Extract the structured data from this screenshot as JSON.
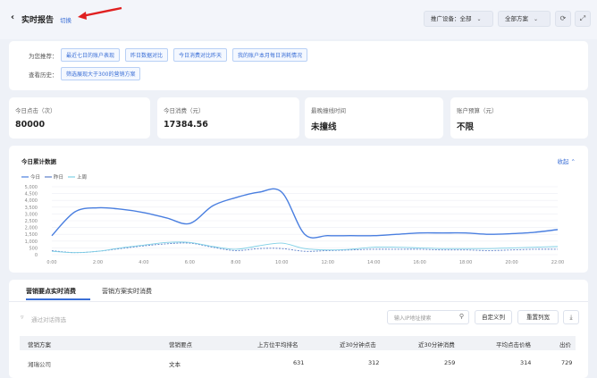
{
  "header": {
    "back_icon": "chevron-left-icon",
    "title": "实时报告",
    "switch_label": "切换",
    "device_select": "推广设备：全部",
    "plan_select": "全部方案",
    "refresh_icon": "refresh-icon",
    "fullscreen_icon": "expand-icon",
    "annotation_arrow_color": "#e02020"
  },
  "recommend": {
    "label": "为您推荐：",
    "tags": [
      "最近七日的账户表现",
      "昨日数据对比",
      "今日消费对比昨天",
      "我的账户本月每日消耗情况"
    ],
    "history_label": "查看历史：",
    "history_tags": [
      "筛选展现大于300的营销方案"
    ]
  },
  "stats": [
    {
      "label": "今日点击（次）",
      "value": "80000"
    },
    {
      "label": "今日消费（元）",
      "value": "17384.56"
    },
    {
      "label": "最晚撞线时间",
      "value": "未撞线"
    },
    {
      "label": "账户预算（元）",
      "value": "不限"
    }
  ],
  "chart_section": {
    "title": "今日累计数据",
    "collapse_label": "收起 ⌃"
  },
  "chart_data": {
    "type": "line",
    "x": [
      "0:00",
      "1:00",
      "2:00",
      "3:00",
      "4:00",
      "5:00",
      "6:00",
      "7:00",
      "8:00",
      "9:00",
      "10:00",
      "11:00",
      "12:00",
      "13:00",
      "14:00",
      "15:00",
      "16:00",
      "17:00",
      "18:00",
      "19:00",
      "20:00",
      "21:00",
      "22:00"
    ],
    "xticks": [
      "0:00",
      "2:00",
      "4:00",
      "6:00",
      "8:00",
      "10:00",
      "12:00",
      "14:00",
      "16:00",
      "18:00",
      "20:00",
      "22:00"
    ],
    "yticks": [
      "0",
      "500",
      "1,000",
      "1,500",
      "2,000",
      "2,500",
      "3,000",
      "3,500",
      "4,000",
      "4,500",
      "5,000"
    ],
    "ylim": [
      0,
      5000
    ],
    "legend_position": "top-left",
    "series": [
      {
        "name": "今日",
        "color": "#4a7fe0",
        "values": [
          1400,
          3150,
          3450,
          3350,
          3100,
          2700,
          2300,
          3600,
          4200,
          4600,
          4600,
          1500,
          1400,
          1400,
          1400,
          1500,
          1600,
          1600,
          1600,
          1500,
          1550,
          1650,
          1850
        ]
      },
      {
        "name": "昨日",
        "color": "#5b7fc9",
        "values": [
          300,
          150,
          250,
          450,
          650,
          800,
          850,
          550,
          300,
          450,
          450,
          250,
          300,
          350,
          400,
          400,
          400,
          350,
          350,
          300,
          350,
          400,
          400
        ]
      },
      {
        "name": "上周",
        "color": "#7fd0e6",
        "values": [
          250,
          150,
          250,
          500,
          700,
          900,
          900,
          600,
          400,
          650,
          850,
          450,
          350,
          400,
          550,
          550,
          500,
          450,
          450,
          450,
          500,
          550,
          600
        ]
      }
    ]
  },
  "table_section": {
    "tabs": [
      "营销要点实时消费",
      "营销方案实时消费"
    ],
    "filter_placeholder": "通过对话筛选",
    "ip_placeholder": "输入IP地址搜索",
    "custom_columns": "自定义列",
    "reset_columns": "重置列宽",
    "columns": [
      "营销方案",
      "营销要点",
      "上方位平均排名",
      "近30分钟点击",
      "近30分钟消费",
      "平均点击价格",
      "出价"
    ],
    "rows": [
      [
        "湘瑞公司",
        "文本",
        "631",
        "312",
        "259",
        "314",
        "729"
      ]
    ]
  }
}
